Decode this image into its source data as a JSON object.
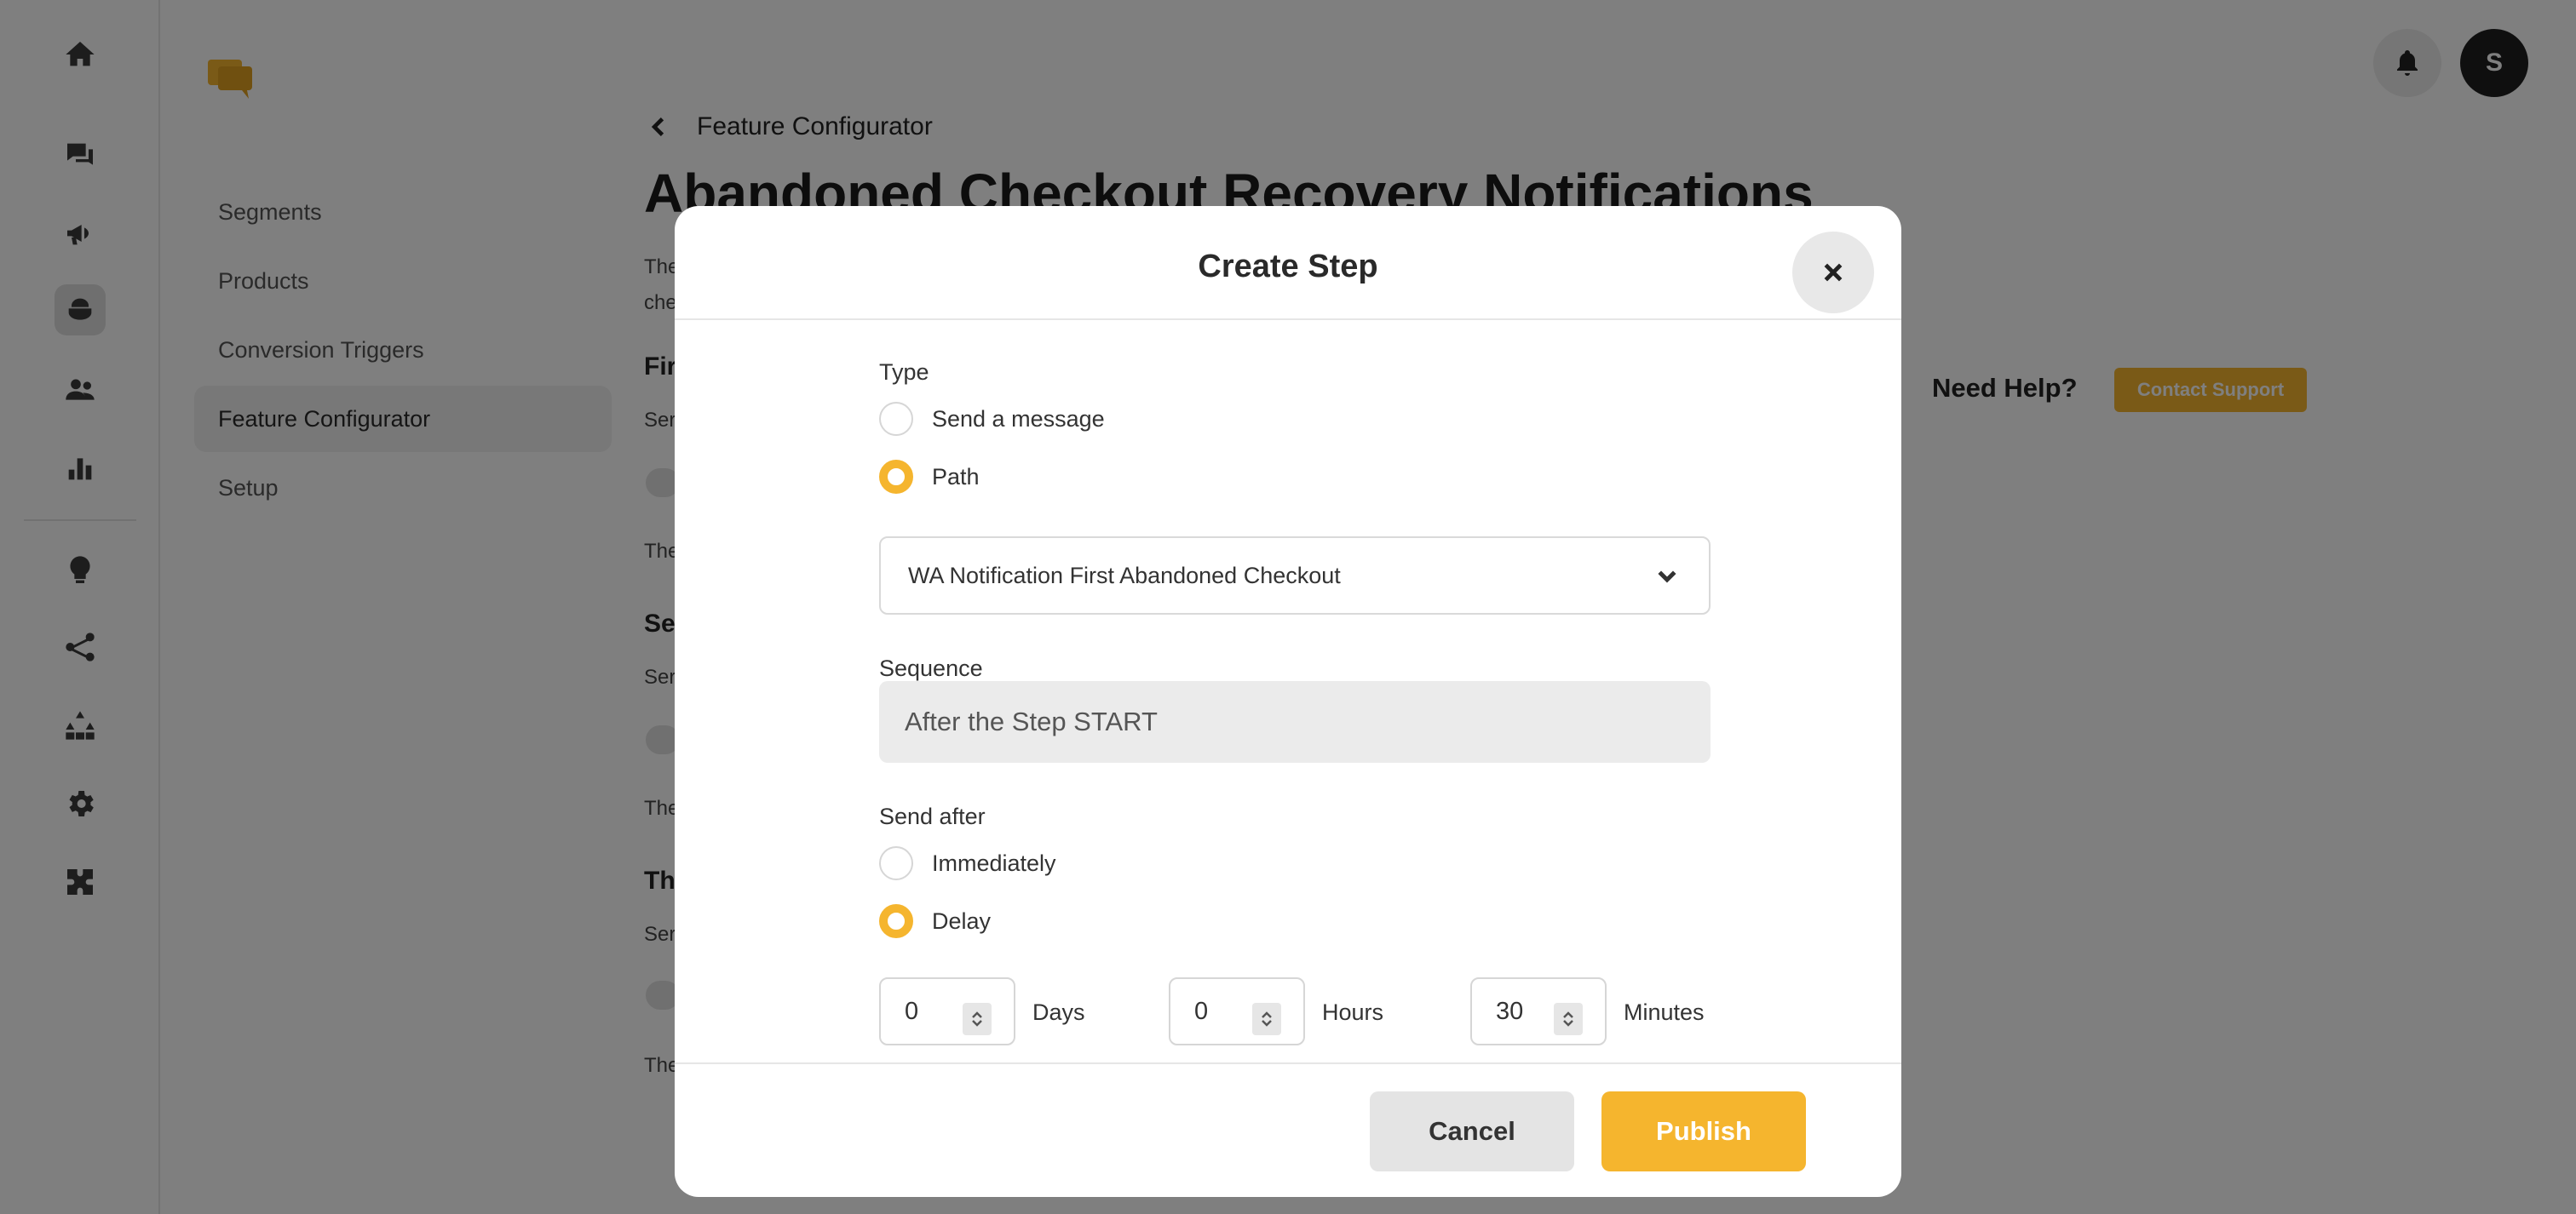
{
  "sidebar_icons": [
    "home-icon",
    "chat-icon",
    "megaphone-icon",
    "bot-icon",
    "users-icon",
    "bar-chart-icon",
    "lightbulb-icon",
    "flow-icon",
    "hierarchy-icon",
    "gear-icon",
    "puzzle-icon"
  ],
  "subnav": {
    "items": [
      {
        "label": "Segments"
      },
      {
        "label": "Products"
      },
      {
        "label": "Conversion Triggers"
      },
      {
        "label": "Feature Configurator"
      },
      {
        "label": "Setup"
      }
    ]
  },
  "header": {
    "avatar_initial": "S",
    "breadcrumb": "Feature Configurator",
    "page_title": "Abandoned Checkout Recovery Notifications"
  },
  "background_fragments": {
    "desc_line1": "The",
    "desc_line2": "che",
    "first_heading": "Fir",
    "send_1": "Ser",
    "note_1": "The",
    "second_heading": "Sec",
    "send_2": "Ser",
    "note_2": "The",
    "third_heading": "Th",
    "send_3": "Ser",
    "note_3": "The"
  },
  "help": {
    "title": "Need Help?",
    "button": "Contact Support"
  },
  "modal": {
    "title": "Create Step",
    "type_label": "Type",
    "type_options": [
      "Send a message",
      "Path"
    ],
    "selected_type": "Path",
    "path_select_value": "WA Notification First Abandoned Checkout",
    "sequence_label": "Sequence",
    "sequence_value": "After the Step START",
    "send_after_label": "Send after",
    "send_after_options": [
      "Immediately",
      "Delay"
    ],
    "selected_send_after": "Delay",
    "delay": {
      "days": "0",
      "days_label": "Days",
      "hours": "0",
      "hours_label": "Hours",
      "minutes": "30",
      "minutes_label": "Minutes"
    },
    "cancel_label": "Cancel",
    "publish_label": "Publish"
  },
  "colors": {
    "accent": "#f5b52e",
    "overlay": "rgba(0,0,0,0.5)"
  }
}
